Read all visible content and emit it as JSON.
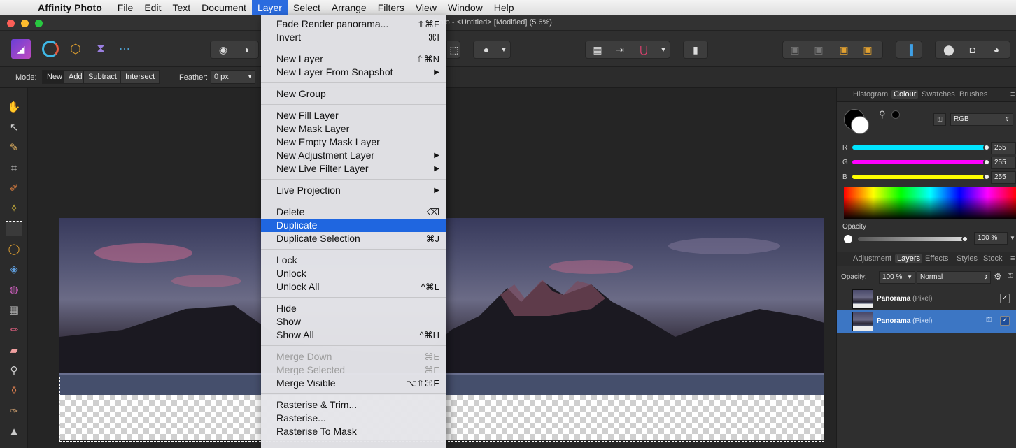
{
  "menubar": {
    "app_name": "Affinity Photo",
    "items": [
      "File",
      "Edit",
      "Text",
      "Document",
      "Layer",
      "Select",
      "Arrange",
      "Filters",
      "View",
      "Window",
      "Help"
    ],
    "active": "Layer"
  },
  "window": {
    "title": "ity Photo - <Untitled> [Modified] (5.6%)"
  },
  "context_bar": {
    "mode_label": "Mode:",
    "modes": [
      "New",
      "Add",
      "Subtract",
      "Intersect"
    ],
    "feather_label": "Feather:",
    "feather_value": "0 px"
  },
  "layer_menu": {
    "items": [
      {
        "label": "Fade Render panorama...",
        "shortcut": "⇧⌘F"
      },
      {
        "label": "Invert",
        "shortcut": "⌘I"
      },
      {
        "sep": true
      },
      {
        "label": "New Layer",
        "shortcut": "⇧⌘N"
      },
      {
        "label": "New Layer From Snapshot",
        "shortcut": "▶"
      },
      {
        "sep": true
      },
      {
        "label": "New Group",
        "shortcut": ""
      },
      {
        "sep": true
      },
      {
        "label": "New Fill Layer",
        "shortcut": ""
      },
      {
        "label": "New Mask Layer",
        "shortcut": ""
      },
      {
        "label": "New Empty Mask Layer",
        "shortcut": ""
      },
      {
        "label": "New Adjustment Layer",
        "shortcut": "▶"
      },
      {
        "label": "New Live Filter Layer",
        "shortcut": "▶"
      },
      {
        "sep": true
      },
      {
        "label": "Live Projection",
        "shortcut": "▶"
      },
      {
        "sep": true
      },
      {
        "label": "Delete",
        "shortcut": "⌫"
      },
      {
        "label": "Duplicate",
        "shortcut": "",
        "highlighted": true
      },
      {
        "label": "Duplicate Selection",
        "shortcut": "⌘J"
      },
      {
        "sep": true
      },
      {
        "label": "Lock",
        "shortcut": ""
      },
      {
        "label": "Unlock",
        "shortcut": ""
      },
      {
        "label": "Unlock All",
        "shortcut": "^⌘L"
      },
      {
        "sep": true
      },
      {
        "label": "Hide",
        "shortcut": ""
      },
      {
        "label": "Show",
        "shortcut": ""
      },
      {
        "label": "Show All",
        "shortcut": "^⌘H"
      },
      {
        "sep": true
      },
      {
        "label": "Merge Down",
        "shortcut": "⌘E",
        "disabled": true
      },
      {
        "label": "Merge Selected",
        "shortcut": "⌘E",
        "disabled": true
      },
      {
        "label": "Merge Visible",
        "shortcut": "⌥⇧⌘E"
      },
      {
        "sep": true
      },
      {
        "label": "Rasterise & Trim...",
        "shortcut": ""
      },
      {
        "label": "Rasterise...",
        "shortcut": ""
      },
      {
        "label": "Rasterise To Mask",
        "shortcut": ""
      },
      {
        "sep": true
      }
    ]
  },
  "colour_panel": {
    "tabs": [
      "Histogram",
      "Colour",
      "Swatches",
      "Brushes"
    ],
    "active_tab": "Colour",
    "model": "RGB",
    "channels": [
      {
        "name": "R",
        "value": "255",
        "color": "#00e5ff"
      },
      {
        "name": "G",
        "value": "255",
        "color": "#ff00ff"
      },
      {
        "name": "B",
        "value": "255",
        "color": "#ffff00"
      }
    ],
    "opacity_label": "Opacity",
    "opacity_value": "100 %"
  },
  "layers_panel": {
    "tabs": [
      "Adjustment",
      "Layers",
      "Effects",
      "Styles",
      "Stock"
    ],
    "active_tab": "Layers",
    "opacity_label": "Opacity:",
    "opacity_value": "100 %",
    "blend_mode": "Normal",
    "layers": [
      {
        "name": "Panorama",
        "type": "(Pixel)",
        "selected": false,
        "locked": false
      },
      {
        "name": "Panorama",
        "type": "(Pixel)",
        "selected": true,
        "locked": true
      }
    ]
  },
  "icons": {
    "checkmark": "✓",
    "lock": "🔒",
    "gear": "⚙"
  }
}
